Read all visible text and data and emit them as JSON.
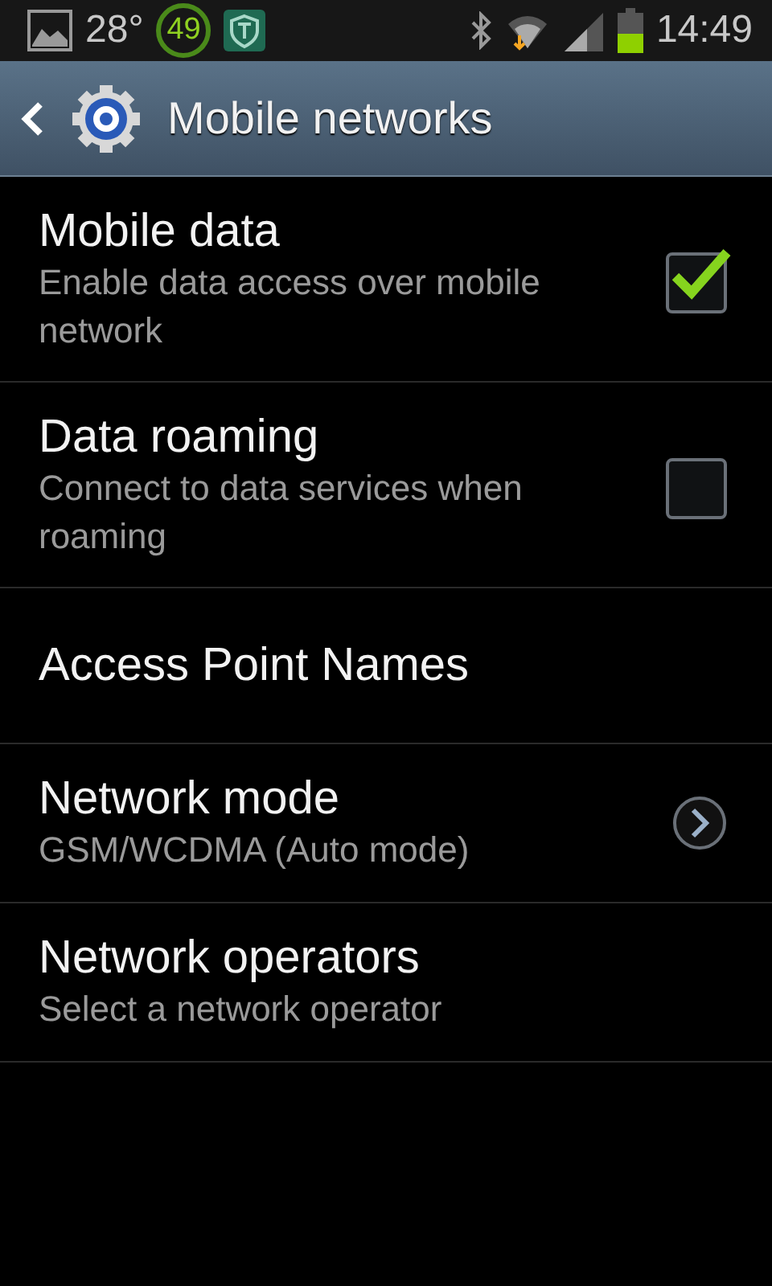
{
  "status_bar": {
    "temperature": "28°",
    "badge": "49",
    "time": "14:49"
  },
  "action_bar": {
    "title": "Mobile networks"
  },
  "settings": [
    {
      "kind": "checkbox",
      "title": "Mobile data",
      "summary": "Enable data access over mobile network",
      "checked": true
    },
    {
      "kind": "checkbox",
      "title": "Data roaming",
      "summary": "Connect to data services when roaming",
      "checked": false
    },
    {
      "kind": "plain",
      "title": "Access Point Names"
    },
    {
      "kind": "chevron",
      "title": "Network mode",
      "summary": "GSM/WCDMA (Auto mode)"
    },
    {
      "kind": "plain",
      "title": "Network operators",
      "summary": "Select a network operator"
    }
  ]
}
